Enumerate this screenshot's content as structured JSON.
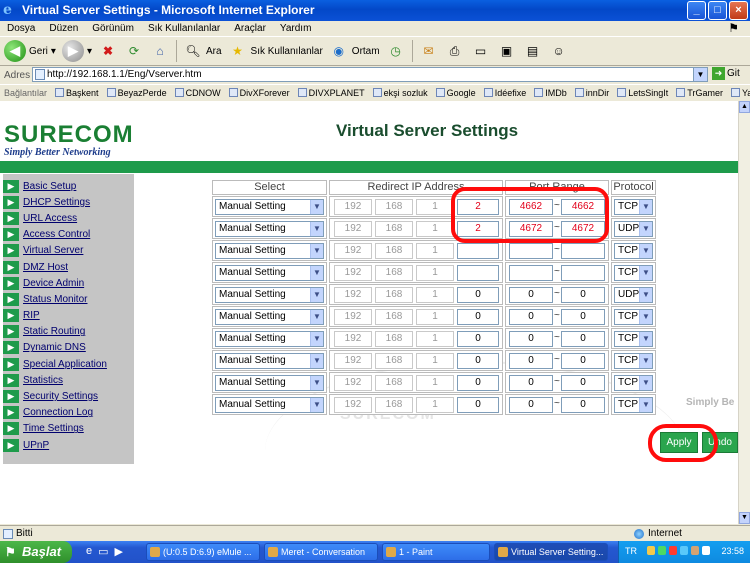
{
  "window": {
    "title": "Virtual Server Settings - Microsoft Internet Explorer",
    "buttons": [
      "_",
      "□",
      "×"
    ]
  },
  "menubar": [
    "Dosya",
    "Düzen",
    "Görünüm",
    "Sık Kullanılanlar",
    "Araçlar",
    "Yardım"
  ],
  "toolbar": {
    "back": "Geri",
    "search": "Ara",
    "favorites": "Sık Kullanılanlar",
    "media": "Ortam"
  },
  "address": {
    "label": "Adres",
    "url": "http://192.168.1.1/Eng/Vserver.htm",
    "go": "Git"
  },
  "links": {
    "label": "Bağlantılar",
    "items": [
      "Başkent",
      "BeyazPerde",
      "CDNOW",
      "DivXForever",
      "DIVXPLANET",
      "ekşi sozluk",
      "Google",
      "Idéefixe",
      "IMDb",
      "innDir",
      "LetsSingIt",
      "TrGamer",
      "Yahoo!"
    ]
  },
  "page": {
    "brand": "SURECOM",
    "slogan": "Simply Better Networking",
    "title": "Virtual Server Settings",
    "watermark": "Simply Be",
    "watermark_logo": "SURECOM"
  },
  "sidebar": {
    "items": [
      "Basic Setup",
      "DHCP Settings",
      "URL Access",
      "Access Control",
      "Virtual Server",
      "DMZ Host",
      "Device Admin",
      "Status Monitor",
      "RIP",
      "Static Routing",
      "Dynamic DNS",
      "Special Application",
      "Statistics",
      "Security Settings",
      "Connection Log",
      "Time Settings",
      "UPnP"
    ]
  },
  "table": {
    "headers": {
      "select": "Select",
      "ip": "Redirect IP Address",
      "port": "Port Range",
      "protocol": "Protocol"
    },
    "port_separator": "~",
    "rows": [
      {
        "select": "Manual Setting",
        "ip": [
          "192",
          "168",
          "1",
          "2"
        ],
        "port_start": "4662",
        "port_end": "4662",
        "protocol": "TCP"
      },
      {
        "select": "Manual Setting",
        "ip": [
          "192",
          "168",
          "1",
          "2"
        ],
        "port_start": "4672",
        "port_end": "4672",
        "protocol": "UDP"
      },
      {
        "select": "Manual Setting",
        "ip": [
          "192",
          "168",
          "1",
          ""
        ],
        "port_start": "",
        "port_end": "",
        "protocol": "TCP"
      },
      {
        "select": "Manual Setting",
        "ip": [
          "192",
          "168",
          "1",
          ""
        ],
        "port_start": "",
        "port_end": "",
        "protocol": "TCP"
      },
      {
        "select": "Manual Setting",
        "ip": [
          "192",
          "168",
          "1",
          "0"
        ],
        "port_start": "0",
        "port_end": "0",
        "protocol": "UDP"
      },
      {
        "select": "Manual Setting",
        "ip": [
          "192",
          "168",
          "1",
          "0"
        ],
        "port_start": "0",
        "port_end": "0",
        "protocol": "TCP"
      },
      {
        "select": "Manual Setting",
        "ip": [
          "192",
          "168",
          "1",
          "0"
        ],
        "port_start": "0",
        "port_end": "0",
        "protocol": "TCP"
      },
      {
        "select": "Manual Setting",
        "ip": [
          "192",
          "168",
          "1",
          "0"
        ],
        "port_start": "0",
        "port_end": "0",
        "protocol": "TCP"
      },
      {
        "select": "Manual Setting",
        "ip": [
          "192",
          "168",
          "1",
          "0"
        ],
        "port_start": "0",
        "port_end": "0",
        "protocol": "TCP"
      },
      {
        "select": "Manual Setting",
        "ip": [
          "192",
          "168",
          "1",
          "0"
        ],
        "port_start": "0",
        "port_end": "0",
        "protocol": "TCP"
      }
    ]
  },
  "buttons": {
    "apply": "Apply",
    "undo": "Undo"
  },
  "status": {
    "text": "Bitti",
    "zone": "Internet"
  },
  "taskbar": {
    "start": "Başlat",
    "tasks": [
      "(U:0.5 D:6.9) eMule ...",
      "Meret - Conversation",
      "1 - Paint",
      "Virtual Server Setting..."
    ],
    "lang": "TR",
    "time": "23:58"
  },
  "colors": {
    "accent_green": "#1e9b4b",
    "annotation_red": "#ff0c0c",
    "xp_blue": "#0348c8"
  }
}
